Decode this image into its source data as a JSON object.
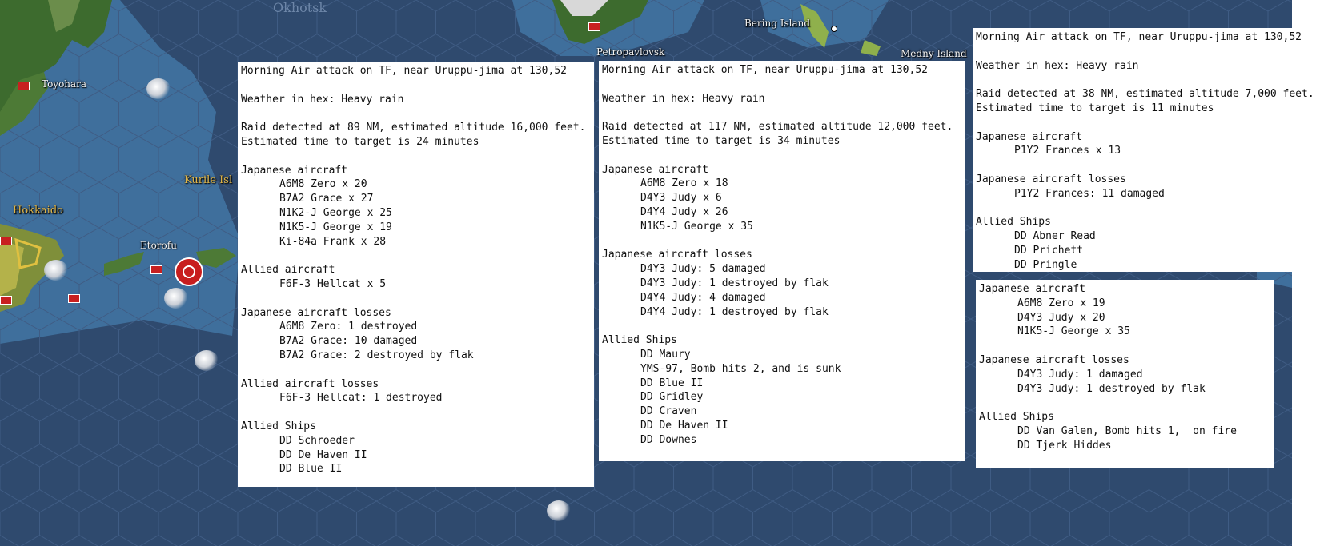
{
  "map": {
    "labels": {
      "okhotsk": "Okhotsk",
      "toyohara": "Toyohara",
      "kurile": "Kurile Isl",
      "hokkaido": "Hokkaido",
      "etorofu": "Etorofu",
      "petropavlovsk": "Petropavlovsk",
      "bering": "Bering Island",
      "medny": "Medny Island"
    }
  },
  "reports": {
    "r1": {
      "title": "Morning Air attack on TF, near Uruppu-jima at 130,52",
      "weather": "Weather in hex: Heavy rain",
      "raid": "Raid detected at 89 NM, estimated altitude 16,000 feet.",
      "eta": "Estimated time to target is 24 minutes",
      "jp_aircraft_header": "Japanese aircraft",
      "jp_aircraft": [
        "A6M8 Zero x 20",
        "B7A2 Grace x 27",
        "N1K2-J George x 25",
        "N1K5-J George x 19",
        "Ki-84a Frank x 28"
      ],
      "allied_aircraft_header": "Allied aircraft",
      "allied_aircraft": [
        "F6F-3 Hellcat x 5"
      ],
      "jp_losses_header": "Japanese aircraft losses",
      "jp_losses": [
        "A6M8 Zero: 1 destroyed",
        "B7A2 Grace: 10 damaged",
        "B7A2 Grace: 2 destroyed by flak"
      ],
      "allied_losses_header": "Allied aircraft losses",
      "allied_losses": [
        "F6F-3 Hellcat: 1 destroyed"
      ],
      "ships_header": "Allied Ships",
      "ships": [
        "DD Schroeder",
        "DD De Haven II",
        "DD Blue II"
      ]
    },
    "r2": {
      "title": "Morning Air attack on TF, near Uruppu-jima at 130,52",
      "weather": "Weather in hex: Heavy rain",
      "raid": "Raid detected at 117 NM, estimated altitude 12,000 feet.",
      "eta": "Estimated time to target is 34 minutes",
      "jp_aircraft_header": "Japanese aircraft",
      "jp_aircraft": [
        "A6M8 Zero x 18",
        "D4Y3 Judy x 6",
        "D4Y4 Judy x 26",
        "N1K5-J George x 35"
      ],
      "jp_losses_header": "Japanese aircraft losses",
      "jp_losses": [
        "D4Y3 Judy: 5 damaged",
        "D4Y3 Judy: 1 destroyed by flak",
        "D4Y4 Judy: 4 damaged",
        "D4Y4 Judy: 1 destroyed by flak"
      ],
      "ships_header": "Allied Ships",
      "ships": [
        "DD Maury",
        "YMS-97, Bomb hits 2, and is sunk",
        "DD Blue II",
        "DD Gridley",
        "DD Craven",
        "DD De Haven II",
        "DD Downes"
      ]
    },
    "r3": {
      "title": "Morning Air attack on TF, near Uruppu-jima at 130,52",
      "weather": "Weather in hex: Heavy rain",
      "raid": "Raid detected at 38 NM, estimated altitude 7,000 feet.",
      "eta": "Estimated time to target is 11 minutes",
      "jp_aircraft_header": "Japanese aircraft",
      "jp_aircraft": [
        "P1Y2 Frances x 13"
      ],
      "jp_losses_header": "Japanese aircraft losses",
      "jp_losses": [
        "P1Y2 Frances: 11 damaged"
      ],
      "ships_header": "Allied Ships",
      "ships": [
        "DD Abner Read",
        "DD Prichett",
        "DD Pringle"
      ]
    },
    "r4": {
      "jp_aircraft_header": "Japanese aircraft",
      "jp_aircraft": [
        "A6M8 Zero x 19",
        "D4Y3 Judy x 20",
        "N1K5-J George x 35"
      ],
      "jp_losses_header": "Japanese aircraft losses",
      "jp_losses": [
        "D4Y3 Judy: 1 damaged",
        "D4Y3 Judy: 1 destroyed by flak"
      ],
      "ships_header": "Allied Ships",
      "ships": [
        "DD Van Galen, Bomb hits 1,  on fire",
        "DD Tjerk Hiddes"
      ]
    }
  }
}
